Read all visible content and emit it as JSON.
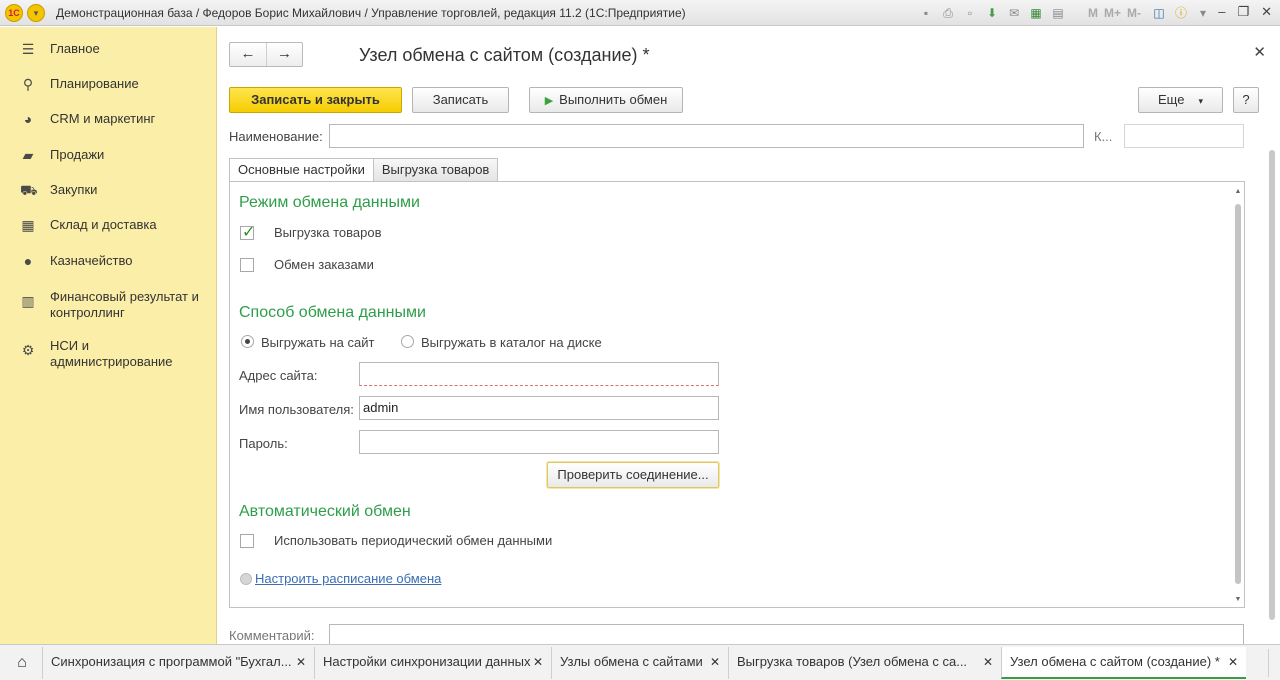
{
  "window": {
    "title": "Демонстрационная база / Федоров Борис Михайлович / Управление торговлей, редакция 11.2  (1С:Предприятие)",
    "logo": "1С",
    "toolbar_icons": [
      "save-icon",
      "print-icon",
      "print-preview-icon",
      "attach-icon",
      "mail-icon",
      "calculator-icon",
      "calendar-icon"
    ],
    "memory_buttons": [
      "M",
      "M+",
      "M-"
    ],
    "window_controls": [
      "minimize-icon",
      "maximize-icon",
      "close-icon"
    ]
  },
  "sidebar": {
    "items": [
      {
        "label": "Главное",
        "icon": "menu-icon"
      },
      {
        "label": "Планирование",
        "icon": "planning-icon"
      },
      {
        "label": "CRM и маркетинг",
        "icon": "crm-icon"
      },
      {
        "label": "Продажи",
        "icon": "sales-icon"
      },
      {
        "label": "Закупки",
        "icon": "purchases-icon"
      },
      {
        "label": "Склад и доставка",
        "icon": "warehouse-icon"
      },
      {
        "label": "Казначейство",
        "icon": "treasury-icon"
      },
      {
        "label": "Финансовый результат и контроллинг",
        "icon": "finance-icon"
      },
      {
        "label": "НСИ и администрирование",
        "icon": "gear-icon"
      }
    ]
  },
  "form": {
    "title": "Узел обмена с сайтом (создание) *",
    "buttons": {
      "save_close": "Записать и закрыть",
      "save": "Записать",
      "run_exchange": "Выполнить обмен",
      "more": "Еще",
      "help": "?"
    },
    "name_label": "Наименование:",
    "name_value": "",
    "code_label": "К...",
    "code_value": "",
    "tabs": [
      "Основные настройки",
      "Выгрузка товаров"
    ],
    "active_tab": "Основные настройки",
    "section_mode": "Режим обмена данными",
    "chk_goods": {
      "label": "Выгрузка товаров",
      "checked": true
    },
    "chk_orders": {
      "label": "Обмен заказами",
      "checked": false
    },
    "section_method": "Способ обмена данными",
    "radio_site": {
      "label": "Выгружать на сайт",
      "selected": true
    },
    "radio_disk": {
      "label": "Выгружать в каталог на диске",
      "selected": false
    },
    "site_address_label": "Адрес сайта:",
    "site_address_value": "",
    "username_label": "Имя пользователя:",
    "username_value": "admin",
    "password_label": "Пароль:",
    "password_value": "",
    "check_connection": "Проверить соединение...",
    "section_auto": "Автоматический обмен",
    "chk_periodic": {
      "label": "Использовать периодический обмен данными",
      "checked": false
    },
    "schedule_link": "Настроить расписание обмена",
    "comment_label": "Комментарий:"
  },
  "bottom_tabs": [
    {
      "label": "Синхронизация с программой \"Бухгал...",
      "active": false
    },
    {
      "label": "Настройки синхронизации данных",
      "active": false
    },
    {
      "label": "Узлы обмена с сайтами",
      "active": false
    },
    {
      "label": "Выгрузка товаров (Узел обмена с са...",
      "active": false
    },
    {
      "label": "Узел обмена с сайтом (создание) *",
      "active": true
    }
  ],
  "colors": {
    "sidebar_bg": "#fbeea8",
    "primary_button": "#f5cd00",
    "section_heading": "#2e9e4a",
    "link": "#3b6db3"
  }
}
